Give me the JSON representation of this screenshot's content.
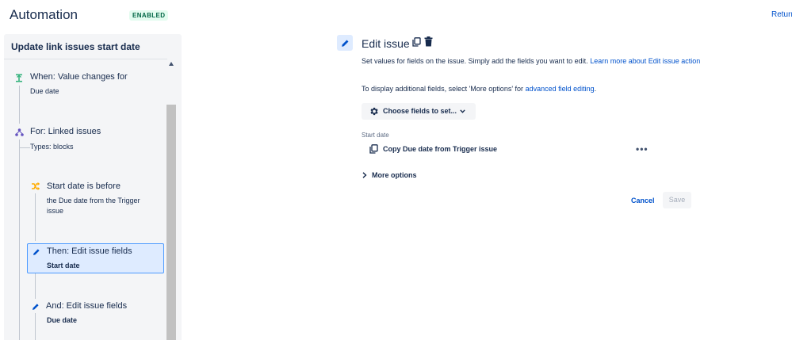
{
  "header": {
    "title": "Automation",
    "status_badge": "ENABLED",
    "return_link": "Return"
  },
  "rule": {
    "name": "Update link issues start date",
    "components": [
      {
        "title": "When: Value changes for",
        "subtitle": "Due date",
        "icon": "trigger-icon",
        "color": "#36B37E"
      },
      {
        "title": "For: Linked issues",
        "subtitle": "Types: blocks",
        "icon": "branch-icon",
        "color": "#6554C0"
      },
      {
        "title": "Start date is before",
        "subtitle": "the Due date from the Trigger issue",
        "icon": "condition-icon",
        "color": "#FFAB00"
      },
      {
        "title": "Then: Edit issue fields",
        "subtitle": "Start date",
        "icon": "pencil-icon",
        "color": "#0052CC",
        "selected": true
      },
      {
        "title": "And: Edit issue fields",
        "subtitle": "Due date",
        "icon": "pencil-icon",
        "color": "#0052CC"
      }
    ]
  },
  "editor": {
    "title": "Edit issue",
    "description": "Set values for fields on the issue. Simply add the fields you want to edit.",
    "learn_more_link": "Learn more about Edit issue action",
    "additional_text": "To display additional fields, select 'More options' for",
    "advanced_link": "advanced field editing",
    "period": ".",
    "choose_button": "Choose fields to set...",
    "field": {
      "label": "Start date",
      "value": "Copy Due date from Trigger issue",
      "menu": "•••"
    },
    "more_options": "More options",
    "cancel_label": "Cancel",
    "save_label": "Save"
  },
  "colors": {
    "primary_link": "#0052CC",
    "text": "#172B4D",
    "badge_text": "#006644",
    "badge_bg": "#E3FCEF",
    "selected_bg": "#DEEBFF",
    "selected_border": "#4C9AFF"
  }
}
